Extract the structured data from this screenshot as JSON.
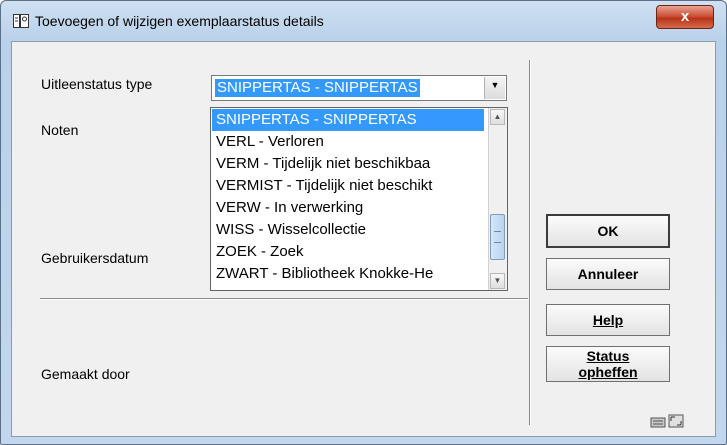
{
  "window": {
    "title": "Toevoegen of wijzigen exemplaarstatus details",
    "close_glyph": "x"
  },
  "form": {
    "status_type_label": "Uitleenstatus type",
    "notes_label": "Noten",
    "user_date_label": "Gebruikersdatum",
    "created_by_label": "Gemaakt  door"
  },
  "combo": {
    "selected_value": "SNIPPERTAS - SNIPPERTAS",
    "arrow_glyph": "▼"
  },
  "dropdown": {
    "items": [
      "SNIPPERTAS - SNIPPERTAS",
      "VERL - Verloren",
      "VERM - Tijdelijk niet beschikbaa",
      "VERMIST - Tijdelijk niet beschikt",
      "VERW - In verwerking",
      "WISS - Wisselcollectie",
      "ZOEK - Zoek",
      "ZWART - Bibliotheek Knokke-He"
    ],
    "selected_index": 0
  },
  "buttons": {
    "ok": "OK",
    "cancel": "Annuleer",
    "help": "Help",
    "status_clear_line1": "Status",
    "status_clear_line2": "opheffen"
  },
  "colors": {
    "selection": "#3399ff",
    "dialog_bg": "#f0f0f0",
    "close_button": "#c9492f"
  }
}
